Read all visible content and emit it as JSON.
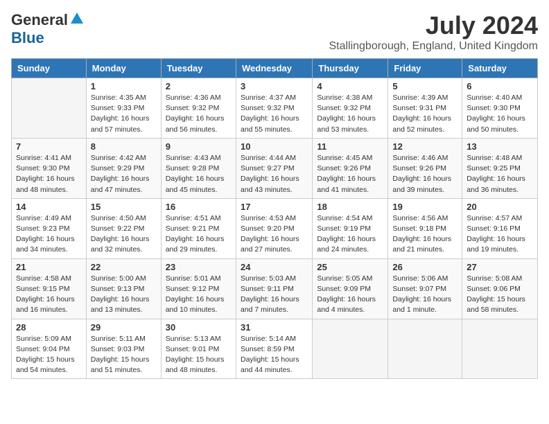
{
  "logo": {
    "general": "General",
    "blue": "Blue"
  },
  "title": {
    "month_year": "July 2024",
    "location": "Stallingborough, England, United Kingdom"
  },
  "weekdays": [
    "Sunday",
    "Monday",
    "Tuesday",
    "Wednesday",
    "Thursday",
    "Friday",
    "Saturday"
  ],
  "weeks": [
    [
      {
        "day": "",
        "info": ""
      },
      {
        "day": "1",
        "info": "Sunrise: 4:35 AM\nSunset: 9:33 PM\nDaylight: 16 hours\nand 57 minutes."
      },
      {
        "day": "2",
        "info": "Sunrise: 4:36 AM\nSunset: 9:32 PM\nDaylight: 16 hours\nand 56 minutes."
      },
      {
        "day": "3",
        "info": "Sunrise: 4:37 AM\nSunset: 9:32 PM\nDaylight: 16 hours\nand 55 minutes."
      },
      {
        "day": "4",
        "info": "Sunrise: 4:38 AM\nSunset: 9:32 PM\nDaylight: 16 hours\nand 53 minutes."
      },
      {
        "day": "5",
        "info": "Sunrise: 4:39 AM\nSunset: 9:31 PM\nDaylight: 16 hours\nand 52 minutes."
      },
      {
        "day": "6",
        "info": "Sunrise: 4:40 AM\nSunset: 9:30 PM\nDaylight: 16 hours\nand 50 minutes."
      }
    ],
    [
      {
        "day": "7",
        "info": "Sunrise: 4:41 AM\nSunset: 9:30 PM\nDaylight: 16 hours\nand 48 minutes."
      },
      {
        "day": "8",
        "info": "Sunrise: 4:42 AM\nSunset: 9:29 PM\nDaylight: 16 hours\nand 47 minutes."
      },
      {
        "day": "9",
        "info": "Sunrise: 4:43 AM\nSunset: 9:28 PM\nDaylight: 16 hours\nand 45 minutes."
      },
      {
        "day": "10",
        "info": "Sunrise: 4:44 AM\nSunset: 9:27 PM\nDaylight: 16 hours\nand 43 minutes."
      },
      {
        "day": "11",
        "info": "Sunrise: 4:45 AM\nSunset: 9:26 PM\nDaylight: 16 hours\nand 41 minutes."
      },
      {
        "day": "12",
        "info": "Sunrise: 4:46 AM\nSunset: 9:26 PM\nDaylight: 16 hours\nand 39 minutes."
      },
      {
        "day": "13",
        "info": "Sunrise: 4:48 AM\nSunset: 9:25 PM\nDaylight: 16 hours\nand 36 minutes."
      }
    ],
    [
      {
        "day": "14",
        "info": "Sunrise: 4:49 AM\nSunset: 9:23 PM\nDaylight: 16 hours\nand 34 minutes."
      },
      {
        "day": "15",
        "info": "Sunrise: 4:50 AM\nSunset: 9:22 PM\nDaylight: 16 hours\nand 32 minutes."
      },
      {
        "day": "16",
        "info": "Sunrise: 4:51 AM\nSunset: 9:21 PM\nDaylight: 16 hours\nand 29 minutes."
      },
      {
        "day": "17",
        "info": "Sunrise: 4:53 AM\nSunset: 9:20 PM\nDaylight: 16 hours\nand 27 minutes."
      },
      {
        "day": "18",
        "info": "Sunrise: 4:54 AM\nSunset: 9:19 PM\nDaylight: 16 hours\nand 24 minutes."
      },
      {
        "day": "19",
        "info": "Sunrise: 4:56 AM\nSunset: 9:18 PM\nDaylight: 16 hours\nand 21 minutes."
      },
      {
        "day": "20",
        "info": "Sunrise: 4:57 AM\nSunset: 9:16 PM\nDaylight: 16 hours\nand 19 minutes."
      }
    ],
    [
      {
        "day": "21",
        "info": "Sunrise: 4:58 AM\nSunset: 9:15 PM\nDaylight: 16 hours\nand 16 minutes."
      },
      {
        "day": "22",
        "info": "Sunrise: 5:00 AM\nSunset: 9:13 PM\nDaylight: 16 hours\nand 13 minutes."
      },
      {
        "day": "23",
        "info": "Sunrise: 5:01 AM\nSunset: 9:12 PM\nDaylight: 16 hours\nand 10 minutes."
      },
      {
        "day": "24",
        "info": "Sunrise: 5:03 AM\nSunset: 9:11 PM\nDaylight: 16 hours\nand 7 minutes."
      },
      {
        "day": "25",
        "info": "Sunrise: 5:05 AM\nSunset: 9:09 PM\nDaylight: 16 hours\nand 4 minutes."
      },
      {
        "day": "26",
        "info": "Sunrise: 5:06 AM\nSunset: 9:07 PM\nDaylight: 16 hours\nand 1 minute."
      },
      {
        "day": "27",
        "info": "Sunrise: 5:08 AM\nSunset: 9:06 PM\nDaylight: 15 hours\nand 58 minutes."
      }
    ],
    [
      {
        "day": "28",
        "info": "Sunrise: 5:09 AM\nSunset: 9:04 PM\nDaylight: 15 hours\nand 54 minutes."
      },
      {
        "day": "29",
        "info": "Sunrise: 5:11 AM\nSunset: 9:03 PM\nDaylight: 15 hours\nand 51 minutes."
      },
      {
        "day": "30",
        "info": "Sunrise: 5:13 AM\nSunset: 9:01 PM\nDaylight: 15 hours\nand 48 minutes."
      },
      {
        "day": "31",
        "info": "Sunrise: 5:14 AM\nSunset: 8:59 PM\nDaylight: 15 hours\nand 44 minutes."
      },
      {
        "day": "",
        "info": ""
      },
      {
        "day": "",
        "info": ""
      },
      {
        "day": "",
        "info": ""
      }
    ]
  ]
}
